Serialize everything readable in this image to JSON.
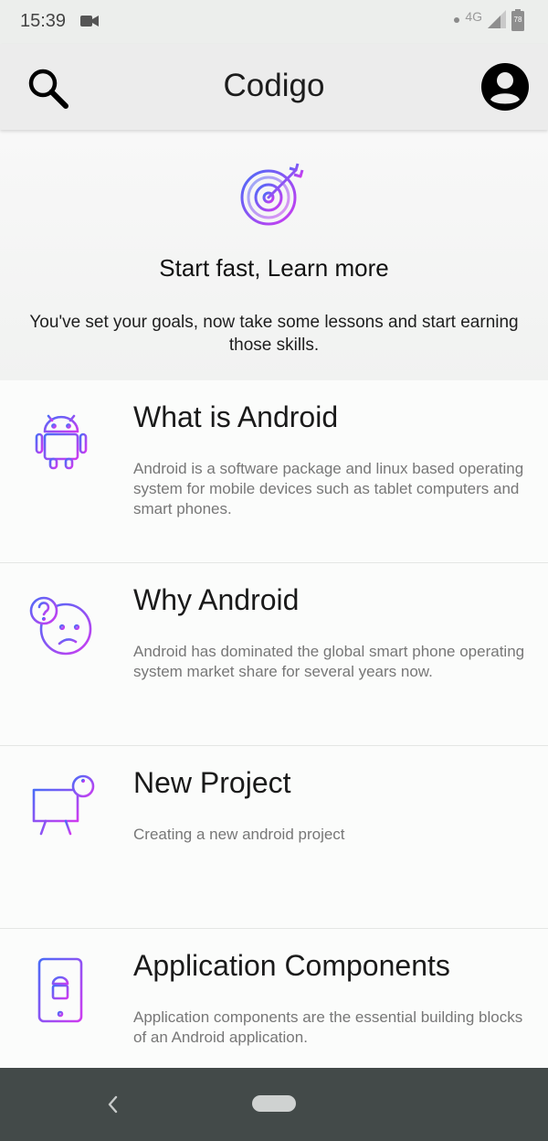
{
  "status_bar": {
    "time": "15:39",
    "network": "4G",
    "battery": "78"
  },
  "app_bar": {
    "title": "Codigo",
    "search_icon": "search-icon",
    "account_icon": "account-circle-icon"
  },
  "hero": {
    "icon": "target-arrow-icon",
    "title": "Start fast, Learn more",
    "subtitle": "You've set your goals, now take some lessons and start earning those skills."
  },
  "lessons": [
    {
      "icon": "android-robot-icon",
      "title": "What is Android",
      "description": "Android is a software package and linux based operating system for mobile devices such as tablet computers and smart phones."
    },
    {
      "icon": "confused-face-question-icon",
      "title": "Why Android",
      "description": "Android has dominated the global smart phone operating system market share for several years now."
    },
    {
      "icon": "presentation-board-info-icon",
      "title": "New Project",
      "description": "Creating a new android project"
    },
    {
      "icon": "phone-android-icon",
      "title": "Application Components",
      "description": "Application components are the essential building blocks of an Android application."
    }
  ],
  "colors": {
    "accent_gradient_start": "#7b4cf5",
    "accent_gradient_end": "#c63bf0",
    "nav_bar": "#434a49"
  }
}
